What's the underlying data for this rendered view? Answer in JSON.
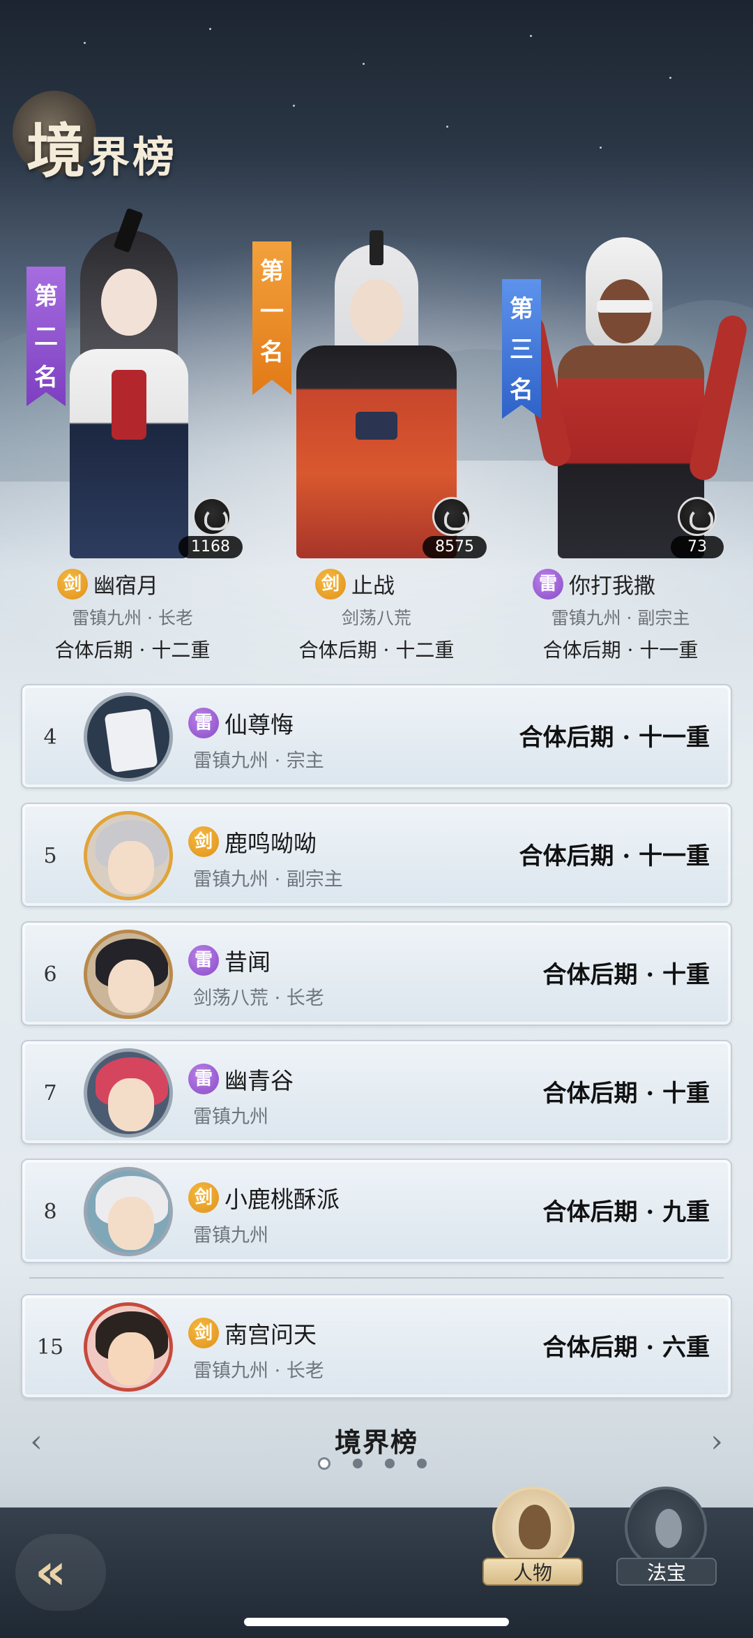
{
  "header": {
    "title_big": "境",
    "title_rest": "界榜"
  },
  "podium": [
    {
      "rank_label": "第二名",
      "rank_chars": [
        "第",
        "二",
        "名"
      ],
      "likes": "1168",
      "badge": "剑",
      "name": "幽宿月",
      "sect": "雷镇九州 · 长老",
      "realm": "合体后期 · 十二重"
    },
    {
      "rank_label": "第一名",
      "rank_chars": [
        "第",
        "一",
        "名"
      ],
      "likes": "8575",
      "badge": "剑",
      "name": "止战",
      "sect": "剑荡八荒",
      "realm": "合体后期 · 十二重"
    },
    {
      "rank_label": "第三名",
      "rank_chars": [
        "第",
        "三",
        "名"
      ],
      "likes": "73",
      "badge": "雷",
      "name": "你打我撒",
      "sect": "雷镇九州 · 副宗主",
      "realm": "合体后期 · 十一重"
    }
  ],
  "rows": [
    {
      "rank": "4",
      "badge": "雷",
      "name": "仙尊悔",
      "sect": "雷镇九州 · 宗主",
      "realm": "合体后期 · 十一重"
    },
    {
      "rank": "5",
      "badge": "剑",
      "name": "鹿鸣呦呦",
      "sect": "雷镇九州 · 副宗主",
      "realm": "合体后期 · 十一重"
    },
    {
      "rank": "6",
      "badge": "雷",
      "name": "昔闻",
      "sect": "剑荡八荒 · 长老",
      "realm": "合体后期 · 十重"
    },
    {
      "rank": "7",
      "badge": "雷",
      "name": "幽青谷",
      "sect": "雷镇九州",
      "realm": "合体后期 · 十重"
    },
    {
      "rank": "8",
      "badge": "剑",
      "name": "小鹿桃酥派",
      "sect": "雷镇九州",
      "realm": "合体后期 · 九重"
    },
    {
      "rank": "15",
      "badge": "剑",
      "name": "南宫问天",
      "sect": "雷镇九州 · 长老",
      "realm": "合体后期 · 六重"
    }
  ],
  "footer": {
    "title": "境界榜",
    "page_count": 4,
    "active_page": 1
  },
  "tabs": {
    "characters": "人物",
    "treasures": "法宝"
  },
  "icons": {
    "back": "back-arrow-icon",
    "prev": "chevron-left-icon",
    "next": "chevron-right-icon",
    "like": "like-icon"
  },
  "colors": {
    "rank1": "#e98a25",
    "rank2": "#8a4bc9",
    "rank3": "#3e74d6",
    "jian": "#e0911a",
    "lei": "#8a4bc9"
  }
}
